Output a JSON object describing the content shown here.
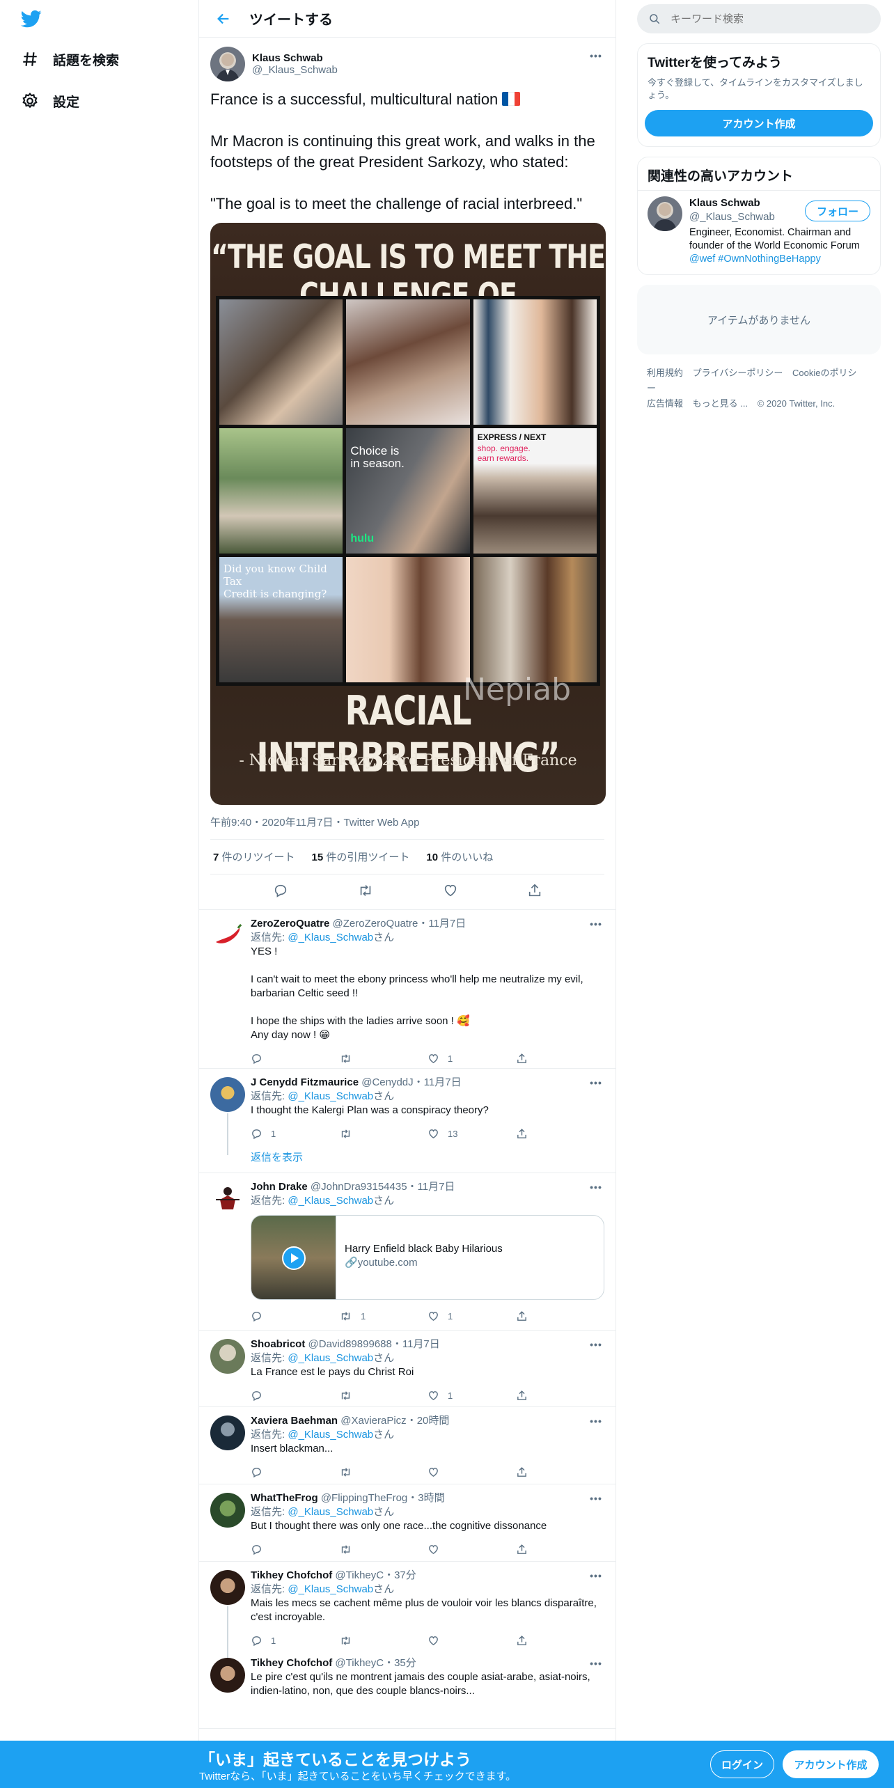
{
  "nav": {
    "explore_label": "話題を検索",
    "settings_label": "設定"
  },
  "header": {
    "title": "ツイートする"
  },
  "main_tweet": {
    "name": "Klaus Schwab",
    "handle": "@_Klaus_Schwab",
    "text_line1": "France is a successful, multicultural nation",
    "text_rest": "Mr Macron is continuing this great work, and walks in the footsteps of the great President Sarkozy, who stated:\n\n\"The goal is to meet the challenge of racial interbreed.\"",
    "media": {
      "quote_top": "“THE GOAL IS TO MEET THE CHALLENGE OF",
      "quote_bottom": "RACIAL INTERBREEDING”",
      "attribution": "- Nicolas Sarkozy, 23rd President of France",
      "watermark": "Nepiab",
      "caption_choice": "Choice is\nin season.",
      "caption_hulu": "hulu",
      "caption_express": "EXPRESS / NEXT",
      "caption_express_sub": "shop. engage.\nearn rewards.",
      "caption_tax": "Did you know Child Tax\nCredit is changing?"
    },
    "meta": "午前9:40・2020年11月7日・Twitter Web App",
    "retweets_num": "7",
    "retweets_label": "件のリツイート",
    "quotes_num": "15",
    "quotes_label": "件の引用ツイート",
    "likes_num": "10",
    "likes_label": "件のいいね"
  },
  "reply_to_prefix": "返信先: ",
  "reply_to_handle": "@_Klaus_Schwab",
  "reply_to_suffix": "さん",
  "replies": [
    {
      "name": "ZeroZeroQuatre",
      "handle": "@ZeroZeroQuatre",
      "time": "・11月7日",
      "text": "YES !\n\nI can't wait to meet the ebony princess who'll help me neutralize my evil, barbarian Celtic seed !!\n\nI hope the ships with the ladies arrive soon ! 🥰\nAny day now ! 😁",
      "reply_count": "",
      "rt_count": "",
      "like_count": "1"
    },
    {
      "name": "J Cenydd Fitzmaurice",
      "handle": "@CenyddJ",
      "time": "・11月7日",
      "text": "I thought the Kalergi Plan was a conspiracy theory?",
      "reply_count": "1",
      "rt_count": "",
      "like_count": "13",
      "show_replies": "返信を表示"
    },
    {
      "name": "John Drake",
      "handle": "@JohnDra93154435",
      "time": "・11月7日",
      "text": "",
      "card_title": "Harry Enfield black Baby Hilarious",
      "card_domain": "youtube.com",
      "reply_count": "",
      "rt_count": "1",
      "like_count": "1"
    },
    {
      "name": "Shoabricot",
      "handle": "@David89899688",
      "time": "・11月7日",
      "text": "La France est le pays du Christ Roi",
      "reply_count": "",
      "rt_count": "",
      "like_count": "1"
    },
    {
      "name": "Xaviera Baehman",
      "handle": "@XavieraPicz",
      "time": "・20時間",
      "text": "Insert blackman...",
      "reply_count": "",
      "rt_count": "",
      "like_count": ""
    },
    {
      "name": "WhatTheFrog",
      "handle": "@FlippingTheFrog",
      "time": "・3時間",
      "text": "But I thought there was only one race...the cognitive dissonance",
      "reply_count": "",
      "rt_count": "",
      "like_count": ""
    },
    {
      "name": "Tikhey Chofchof",
      "handle": "@TikheyC",
      "time": "・37分",
      "text": "Mais les mecs se cachent même plus de vouloir voir les blancs disparaître, c'est incroyable.",
      "reply_count": "1",
      "rt_count": "",
      "like_count": ""
    },
    {
      "name": "Tikhey Chofchof",
      "handle": "@TikheyC",
      "time": "・35分",
      "text": "Le pire c'est qu'ils ne montrent jamais des couple asiat-arabe, asiat-noirs, indien-latino, non, que des couple blancs-noirs..."
    }
  ],
  "right": {
    "search_placeholder": "キーワード検索",
    "signup_title": "Twitterを使ってみよう",
    "signup_desc": "今すぐ登録して、タイムラインをカスタマイズしましょう。",
    "signup_button": "アカウント作成",
    "who_title": "関連性の高いアカウント",
    "who_name": "Klaus Schwab",
    "who_handle": "@_Klaus_Schwab",
    "who_follow": "フォロー",
    "who_bio": "Engineer, Economist. Chairman and founder of the World Economic Forum",
    "who_bio_links": "@wef #OwnNothingBeHappy",
    "empty_text": "アイテムがありません",
    "footer_terms": "利用規約",
    "footer_privacy": "プライバシーポリシー",
    "footer_cookie": "Cookieのポリシー",
    "footer_ads": "広告情報",
    "footer_more": "もっと見る ...",
    "footer_copy": "© 2020 Twitter, Inc."
  },
  "banner": {
    "title": "「いま」起きていることを見つけよう",
    "subtitle": "Twitterなら、「いま」起きていることをいち早くチェックできます。",
    "login": "ログイン",
    "signup": "アカウント作成"
  },
  "colors": {
    "accent": "#1da1f2",
    "link": "#1b95e0",
    "muted": "#5b7083"
  }
}
